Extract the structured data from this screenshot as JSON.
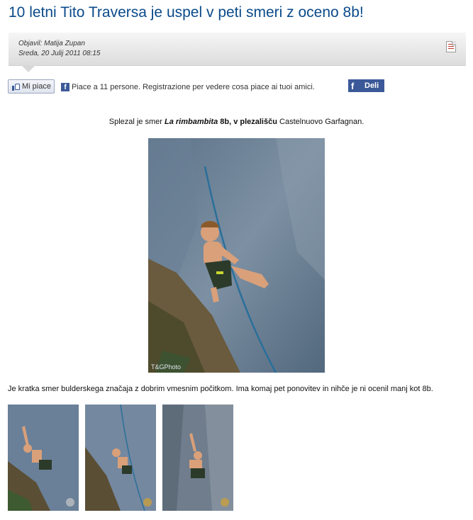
{
  "article": {
    "title": "10 letni Tito Traversa je uspel v peti smeri z oceno 8b!",
    "author": "Objavil: Matija Zupan",
    "date": "Sreda, 20 Julij 2011 08:15"
  },
  "social": {
    "like_label": "Mi piace",
    "like_text": "Piace a 11 persone. Registrazione per vedere cosa piace ai tuoi amici.",
    "share_label": "Deli",
    "fb_letter": "f"
  },
  "caption": {
    "pre": "Splezal je smer ",
    "route": "La rimbambita",
    "grade": " 8b, v plezališču",
    "place": " Castelnuovo Garfagnan."
  },
  "photo": {
    "watermark": "T&GPhoto"
  },
  "description": "Je kratka smer bulderskega značaja z dobrim vmesnim počitkom. Ima komaj pet ponovitev in nihče je ni ocenil manj kot 8b.",
  "icons": {
    "pdf": "pdf-icon",
    "like": "thumbs-up-icon",
    "facebook": "facebook-icon"
  },
  "colors": {
    "title": "#0a4a8a",
    "facebook": "#3b5998"
  }
}
